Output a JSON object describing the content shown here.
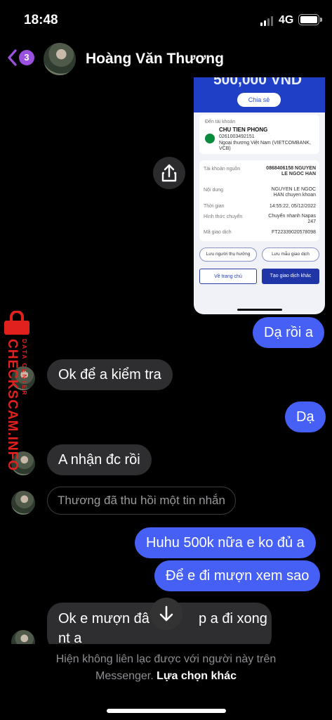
{
  "status_bar": {
    "time": "18:48",
    "network": "4G"
  },
  "header": {
    "badge_count": "3",
    "contact_name": "Hoàng Văn Thương"
  },
  "receipt": {
    "amount": "500,000 VND",
    "share_label": "Chia sẻ",
    "to_account_label": "Đến tài khoản",
    "to_name": "CHU TIEN PHONG",
    "to_number": "0261003492151",
    "to_bank": "Ngoại thương Việt Nam (VIETCOMBANK, VCB)",
    "rows": [
      {
        "label": "Tài khoản nguồn",
        "value": "0868406158 NGUYEN LE NGOC HAN"
      },
      {
        "label": "Nội dung",
        "value": "NGUYEN LE NGOC HAN chuyen khoan"
      },
      {
        "label": "Thời gian",
        "value": "14:55:22, 05/12/2022"
      },
      {
        "label": "Hình thức chuyển",
        "value": "Chuyển nhanh Napas 247"
      },
      {
        "label": "Mã giao dịch",
        "value": "FT22339020578098"
      }
    ],
    "save_recipient": "Lưu người thụ hưởng",
    "save_template": "Lưu mẫu giao dịch",
    "home_button": "Về trang chủ",
    "new_transaction_button": "Tạo giao dịch khác"
  },
  "messages": [
    {
      "text": "Dạ rồi a"
    },
    {
      "text": "Ok để a kiểm tra"
    },
    {
      "text": "Dạ"
    },
    {
      "text": "A nhận đc rồi"
    },
    {
      "text": "Thương đã thu hồi một tin nhắn"
    },
    {
      "text": "Huhu 500k nữa e ko đủ a"
    },
    {
      "text": "Để e đi mượn xem sao"
    },
    {
      "text_line1": "Ok e mượn đâ",
      "text_line1_end": "p a đi xong",
      "text_line2": "nt a"
    }
  ],
  "footer": {
    "notice_line1": "Hiện không liên lạc được với người này trên",
    "notice_line2_prefix": "Messenger.",
    "other_choice": "Lựa chọn khác"
  },
  "watermark": {
    "brand": "CHECKSCAM.INFO",
    "tag": "DATA CENTER"
  },
  "colors": {
    "accent_out": "#4660f5",
    "bubble_in": "#2e2e30",
    "badge": "#9b51e0",
    "watermark": "#e0211e"
  }
}
